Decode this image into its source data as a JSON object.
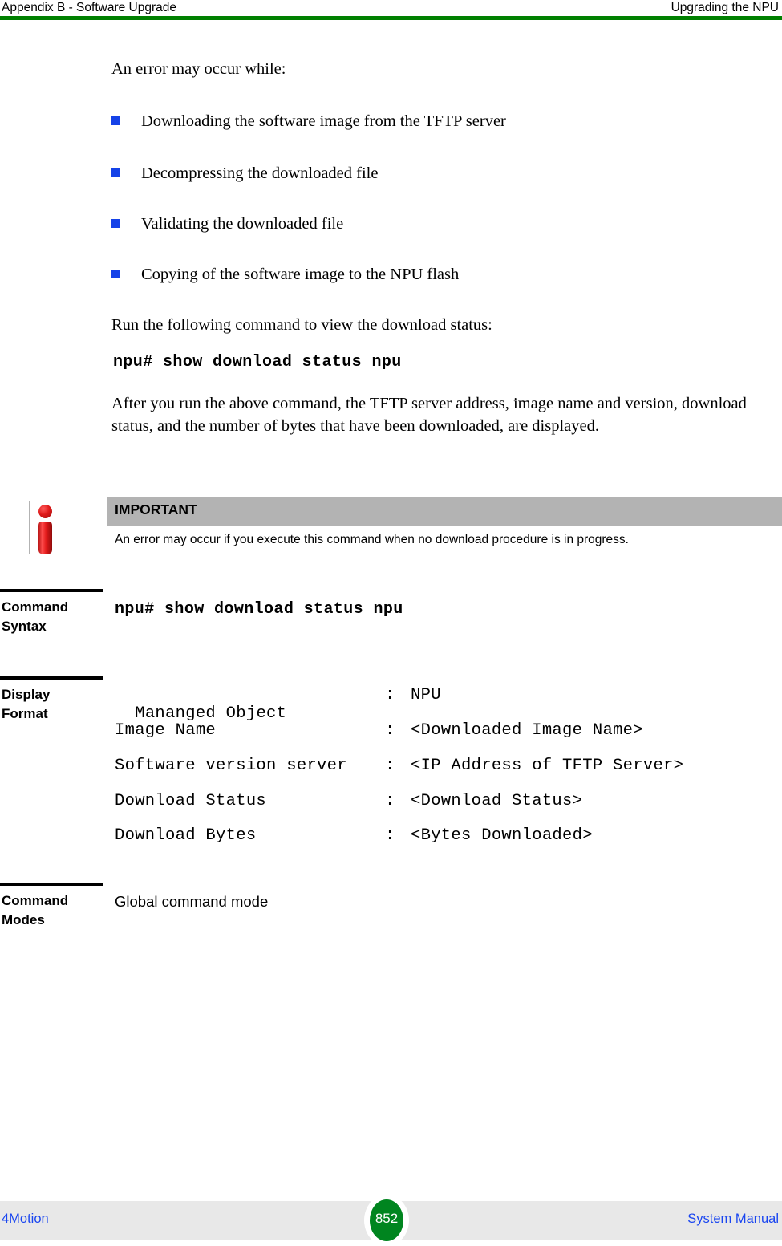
{
  "header": {
    "left": "Appendix B - Software Upgrade",
    "right": "Upgrading the NPU",
    "rule_color": "#008000"
  },
  "body": {
    "intro": "An error may occur while:",
    "bullets": [
      "Downloading the software image from the TFTP server",
      "Decompressing the downloaded file",
      "Validating the downloaded file",
      "Copying of the software image to the NPU flash"
    ],
    "bullet_color": "#1542E8",
    "run_command_intro": "Run the following command to view the download status:",
    "command": "npu# show download status npu",
    "after_paragraph": "After you run the above command, the TFTP server address, image name and version, download status, and the number of bytes that have been downloaded, are displayed."
  },
  "note": {
    "icon": "information-i-icon",
    "title": "IMPORTANT",
    "title_bg": "#b3b3b3",
    "text": "An error may occur if you execute this command when no download procedure is in progress."
  },
  "sections": [
    {
      "label_line1": "Command",
      "label_line2": "Syntax",
      "value": "npu# show download status npu"
    },
    {
      "label_line1": "Display",
      "label_line2": "Format",
      "rows": [
        {
          "field": "Mananged Object",
          "sep": ":",
          "value": "NPU"
        },
        {
          "field": "Image Name",
          "sep": ":",
          "value": "<Downloaded Image Name>"
        },
        {
          "field": "Software version server",
          "sep": ":",
          "value": "<IP Address of TFTP Server>"
        },
        {
          "field": "Download Status",
          "sep": ":",
          "value": "<Download Status>"
        },
        {
          "field": "Download Bytes",
          "sep": ":",
          "value": "<Bytes Downloaded>"
        }
      ]
    },
    {
      "label_line1": "Command",
      "label_line2": "Modes",
      "value": "Global command mode"
    }
  ],
  "footer": {
    "left": "4Motion",
    "page": "852",
    "right": "System Manual",
    "link_color": "#1a46f0",
    "badge_color": "#00851f",
    "band_color": "#e8e8e8"
  }
}
